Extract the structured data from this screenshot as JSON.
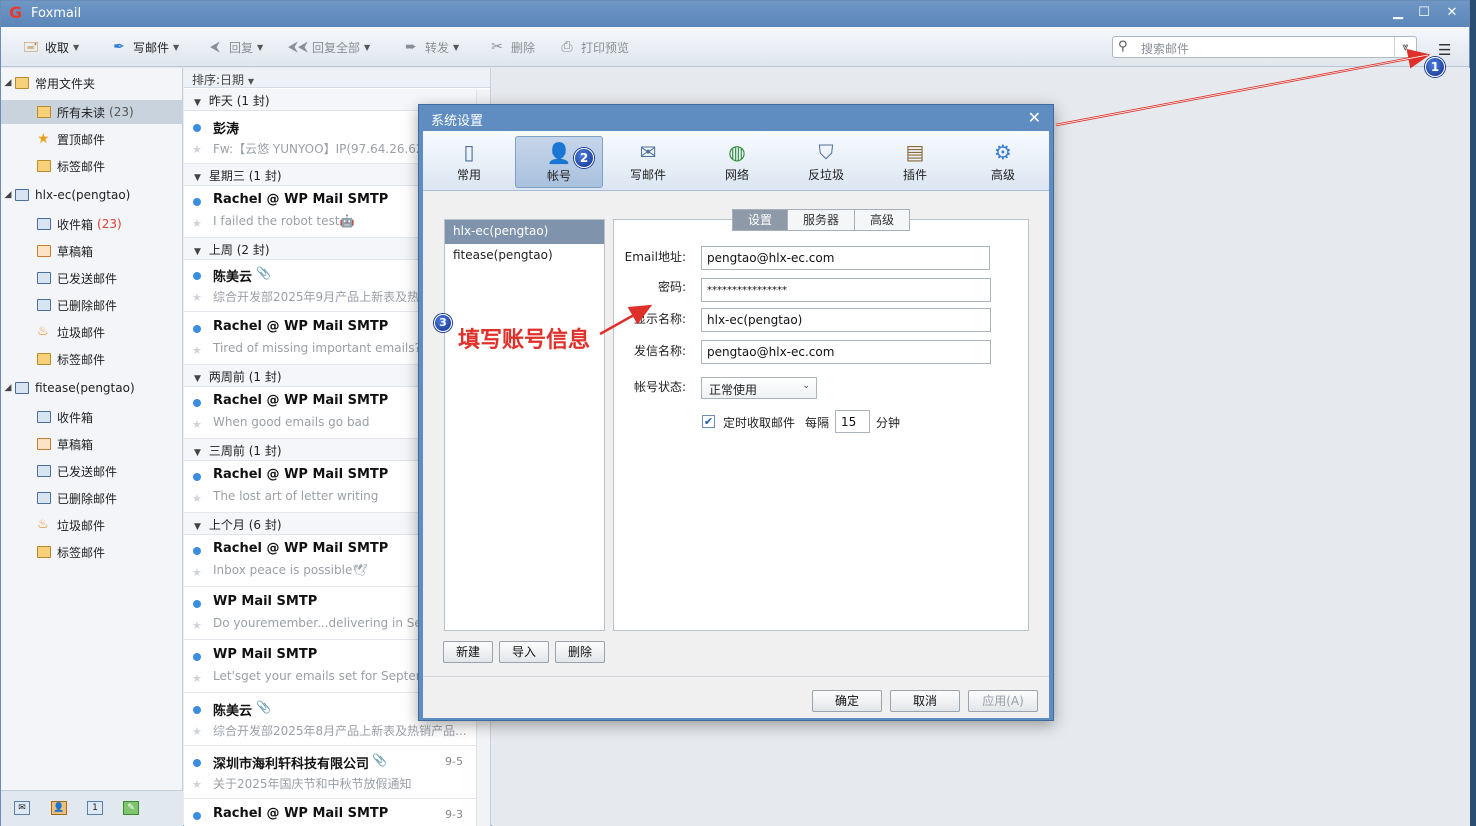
{
  "app": {
    "title": "Foxmail"
  },
  "toolbar": {
    "receive": "收取",
    "compose": "写邮件",
    "reply": "回复",
    "reply_all": "回复全部",
    "forward": "转发",
    "delete": "删除",
    "print_preview": "打印预览",
    "search_placeholder": "搜索邮件"
  },
  "sidebar": {
    "groups": [
      {
        "label": "常用文件夹",
        "items": [
          {
            "label": "所有未读",
            "count": "(23)"
          },
          {
            "label": "置顶邮件"
          },
          {
            "label": "标签邮件"
          }
        ]
      },
      {
        "label": "hlx-ec(pengtao)",
        "items": [
          {
            "label": "收件箱",
            "count": "(23)"
          },
          {
            "label": "草稿箱"
          },
          {
            "label": "已发送邮件"
          },
          {
            "label": "已删除邮件"
          },
          {
            "label": "垃圾邮件"
          },
          {
            "label": "标签邮件"
          }
        ]
      },
      {
        "label": "fitease(pengtao)",
        "items": [
          {
            "label": "收件箱"
          },
          {
            "label": "草稿箱"
          },
          {
            "label": "已发送邮件"
          },
          {
            "label": "已删除邮件"
          },
          {
            "label": "垃圾邮件"
          },
          {
            "label": "标签邮件"
          }
        ]
      }
    ]
  },
  "maillist": {
    "sort_label": "排序:日期",
    "groups": [
      "昨天 (1 封)",
      "星期三 (1 封)",
      "上周 (2 封)",
      "两周前 (1 封)",
      "三周前 (1 封)",
      "上个月 (6 封)"
    ],
    "mails": [
      {
        "from": "彭涛",
        "subject": "Fw:【云悠 YUNYOO】IP(97.64.26.62)",
        "date": ""
      },
      {
        "from": "Rachel @ WP Mail SMTP",
        "subject": "I failed the robot test🤖",
        "date": ""
      },
      {
        "from": "陈美云",
        "subject": "综合开发部2025年9月产品上新表及热",
        "date": ""
      },
      {
        "from": "Rachel @ WP Mail SMTP",
        "subject": "Tired of missing important emails?",
        "date": ""
      },
      {
        "from": "Rachel @ WP Mail SMTP",
        "subject": "When good emails go bad",
        "date": ""
      },
      {
        "from": "Rachel @ WP Mail SMTP",
        "subject": "The lost art of letter writing",
        "date": ""
      },
      {
        "from": "Rachel @ WP Mail SMTP",
        "subject": "Inbox peace is possible🕊",
        "date": ""
      },
      {
        "from": "WP Mail SMTP",
        "subject": "Do youremember...delivering in Sep",
        "date": ""
      },
      {
        "from": "WP Mail SMTP",
        "subject": "Let'sget your emails set for Septem",
        "date": ""
      },
      {
        "from": "陈美云",
        "subject": "综合开发部2025年8月产品上新表及热销产品...",
        "date": ""
      },
      {
        "from": "深圳市海利轩科技有限公司",
        "subject": "关于2025年国庆节和中秋节放假通知",
        "date": "9-5"
      },
      {
        "from": "Rachel @ WP Mail SMTP",
        "subject": "",
        "date": "9-3"
      }
    ]
  },
  "dialog": {
    "title": "系统设置",
    "tabs": [
      "常用",
      "帐号",
      "写邮件",
      "网络",
      "反垃圾",
      "插件",
      "高级"
    ],
    "accounts": [
      "hlx-ec(pengtao)",
      "fitease(pengtao)"
    ],
    "account_buttons": {
      "new": "新建",
      "import": "导入",
      "delete": "删除"
    },
    "settings_tabs": [
      "设置",
      "服务器",
      "高级"
    ],
    "fields": {
      "email_label": "Email地址:",
      "email_value": "pengtao@hlx-ec.com",
      "password_label": "密码:",
      "password_value": "****************",
      "display_name_label": "显示名称:",
      "display_name_value": "hlx-ec(pengtao)",
      "sender_name_label": "发信名称:",
      "sender_name_value": "pengtao@hlx-ec.com",
      "status_label": "帐号状态:",
      "status_value": "正常使用",
      "auto_fetch_label": "定时收取邮件",
      "interval_prefix": "每隔",
      "interval_value": "15",
      "interval_unit": "分钟"
    },
    "footer": {
      "ok": "确定",
      "cancel": "取消",
      "apply": "应用(A)"
    }
  },
  "annotations": {
    "step1": "1",
    "step2": "2",
    "step3": "3",
    "note": "填写账号信息",
    "color": "#e0302a"
  }
}
